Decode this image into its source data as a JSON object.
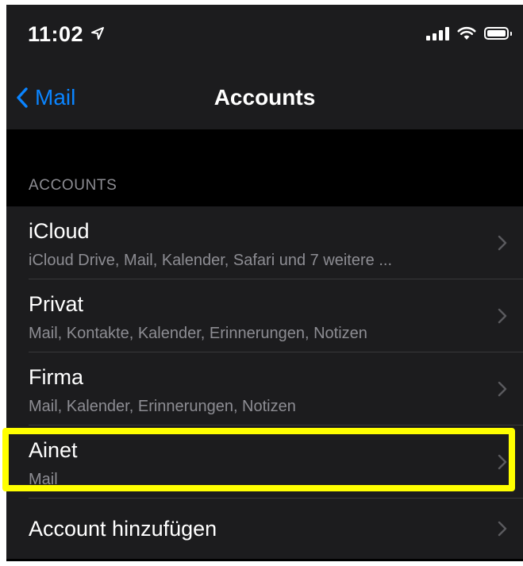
{
  "status_bar": {
    "time": "11:02",
    "icons": [
      "location-arrow-icon",
      "cellular-signal-icon",
      "wifi-icon",
      "battery-icon"
    ]
  },
  "nav": {
    "back_label": "Mail",
    "title": "Accounts"
  },
  "section": {
    "header": "ACCOUNTS"
  },
  "accounts": [
    {
      "title": "iCloud",
      "subtitle": "iCloud Drive, Mail, Kalender, Safari und 7 weitere ..."
    },
    {
      "title": "Privat",
      "subtitle": "Mail, Kontakte, Kalender, Erinnerungen, Notizen"
    },
    {
      "title": "Firma",
      "subtitle": "Mail, Kalender, Erinnerungen, Notizen"
    },
    {
      "title": "Ainet",
      "subtitle": "Mail"
    }
  ],
  "add_account": {
    "label": "Account hinzufügen"
  },
  "colors": {
    "background": "#000000",
    "cell": "#1c1c1e",
    "accent": "#0a84ff",
    "secondary_text": "#8d8d93",
    "highlight": "#ffff00"
  }
}
